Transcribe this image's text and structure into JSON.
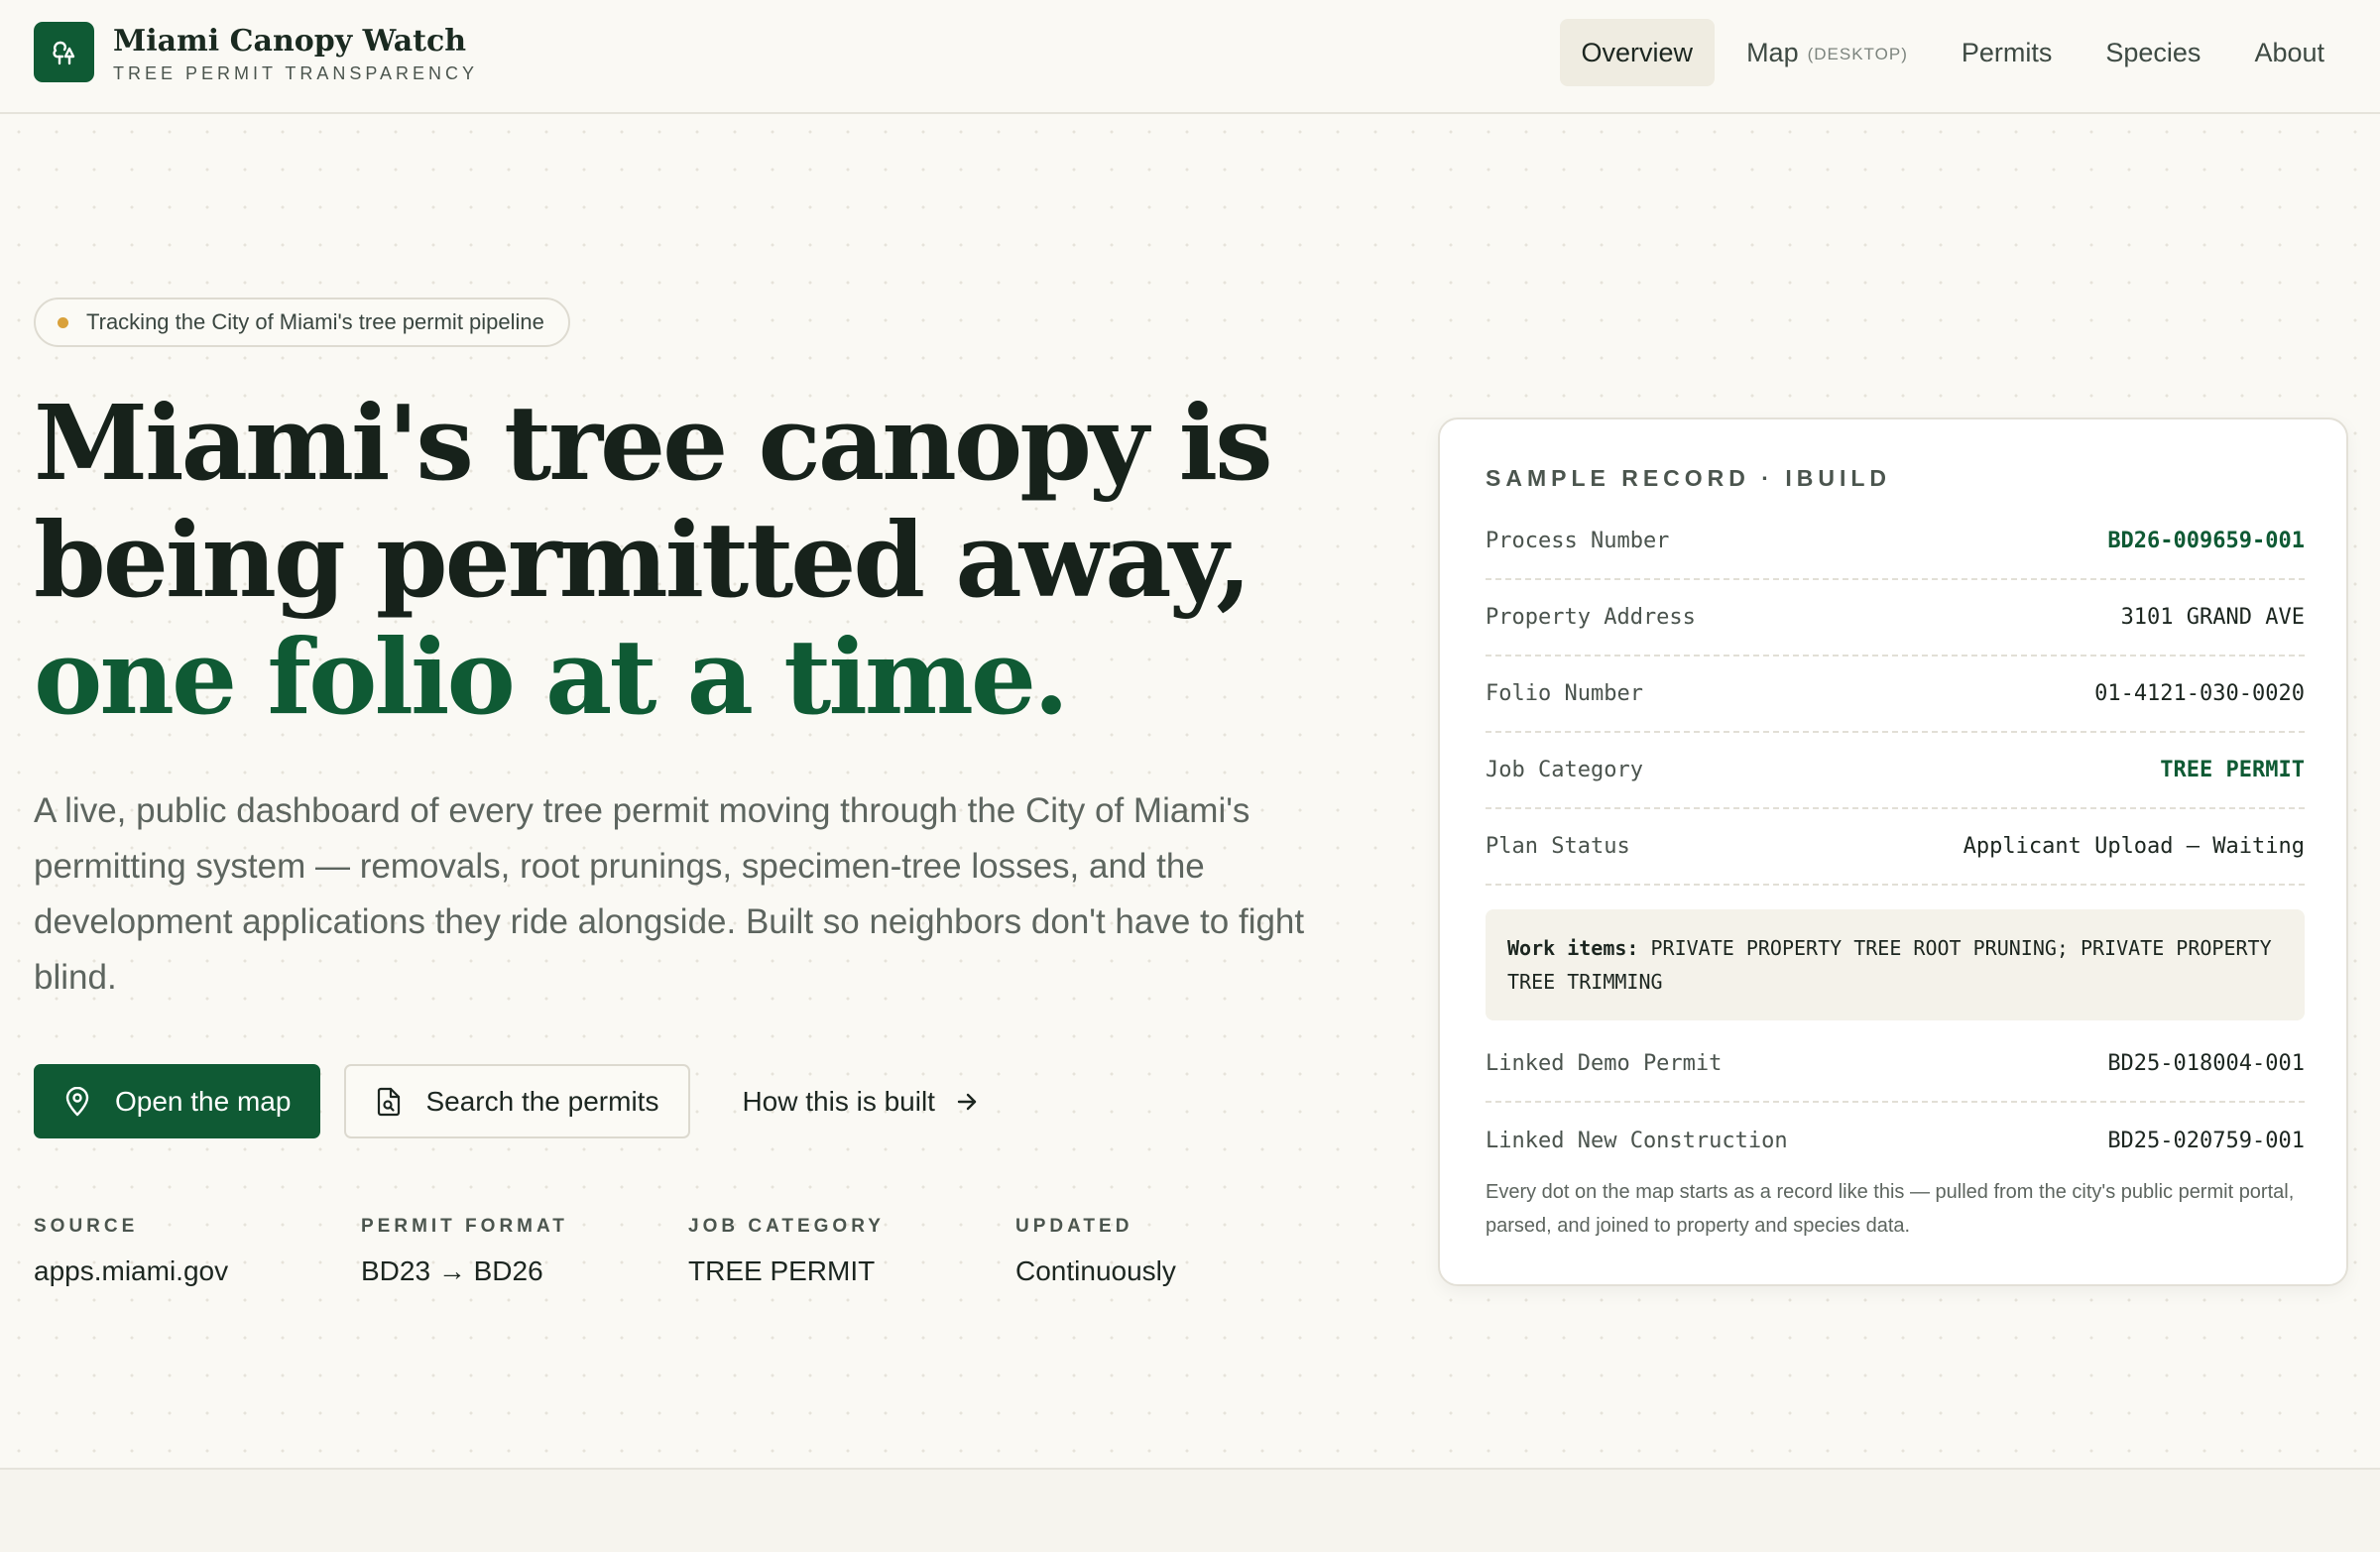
{
  "brand": {
    "title": "Miami Canopy Watch",
    "subtitle": "TREE PERMIT TRANSPARENCY",
    "logo_icon": "tree-icon",
    "accent": "#0f5a34"
  },
  "nav": {
    "items": [
      {
        "label": "Overview",
        "active": true
      },
      {
        "label": "Map",
        "tag": "(DESKTOP)"
      },
      {
        "label": "Permits"
      },
      {
        "label": "Species"
      },
      {
        "label": "About"
      }
    ]
  },
  "hero": {
    "pill_text": "Tracking the City of Miami's tree permit pipeline",
    "pill_dot_color": "#d9a13b",
    "headline_line1": "Miami's tree canopy is",
    "headline_line2": "being permitted away,",
    "headline_green": "one folio at a time.",
    "lede": "A live, public dashboard of every tree permit moving through the City of Miami's permitting system — removals, root prunings, specimen-tree losses, and the development applications they ride alongside. Built so neighbors don't have to fight blind.",
    "cta_primary": "Open the map",
    "cta_primary_icon": "map-pin-icon",
    "cta_secondary": "Search the permits",
    "cta_secondary_icon": "document-search-icon",
    "cta_link": "How this is built",
    "cta_link_icon": "arrow-right-icon"
  },
  "stats": [
    {
      "label": "SOURCE",
      "value": "apps.miami.gov"
    },
    {
      "label": "PERMIT FORMAT",
      "value": "BD23 → BD26"
    },
    {
      "label": "JOB CATEGORY",
      "value": "TREE PERMIT"
    },
    {
      "label": "UPDATED",
      "value": "Continuously"
    }
  ],
  "sample_record": {
    "title": "SAMPLE RECORD · IBUILD",
    "rows_top": [
      {
        "key": "Process Number",
        "value": "BD26-009659-001",
        "highlight": true
      },
      {
        "key": "Property Address",
        "value": "3101 GRAND AVE"
      },
      {
        "key": "Folio Number",
        "value": "01-4121-030-0020"
      },
      {
        "key": "Job Category",
        "value": "TREE PERMIT",
        "highlight": true
      },
      {
        "key": "Plan Status",
        "value": "Applicant Upload — Waiting"
      }
    ],
    "work_items_label": "Work items:",
    "work_items_value": "PRIVATE PROPERTY TREE ROOT PRUNING; PRIVATE PROPERTY TREE TRIMMING",
    "rows_bottom": [
      {
        "key": "Linked Demo Permit",
        "value": "BD25-018004-001"
      },
      {
        "key": "Linked New Construction",
        "value": "BD25-020759-001"
      }
    ],
    "footnote": "Every dot on the map starts as a record like this — pulled from the city's public permit portal, parsed, and joined to property and species data."
  }
}
